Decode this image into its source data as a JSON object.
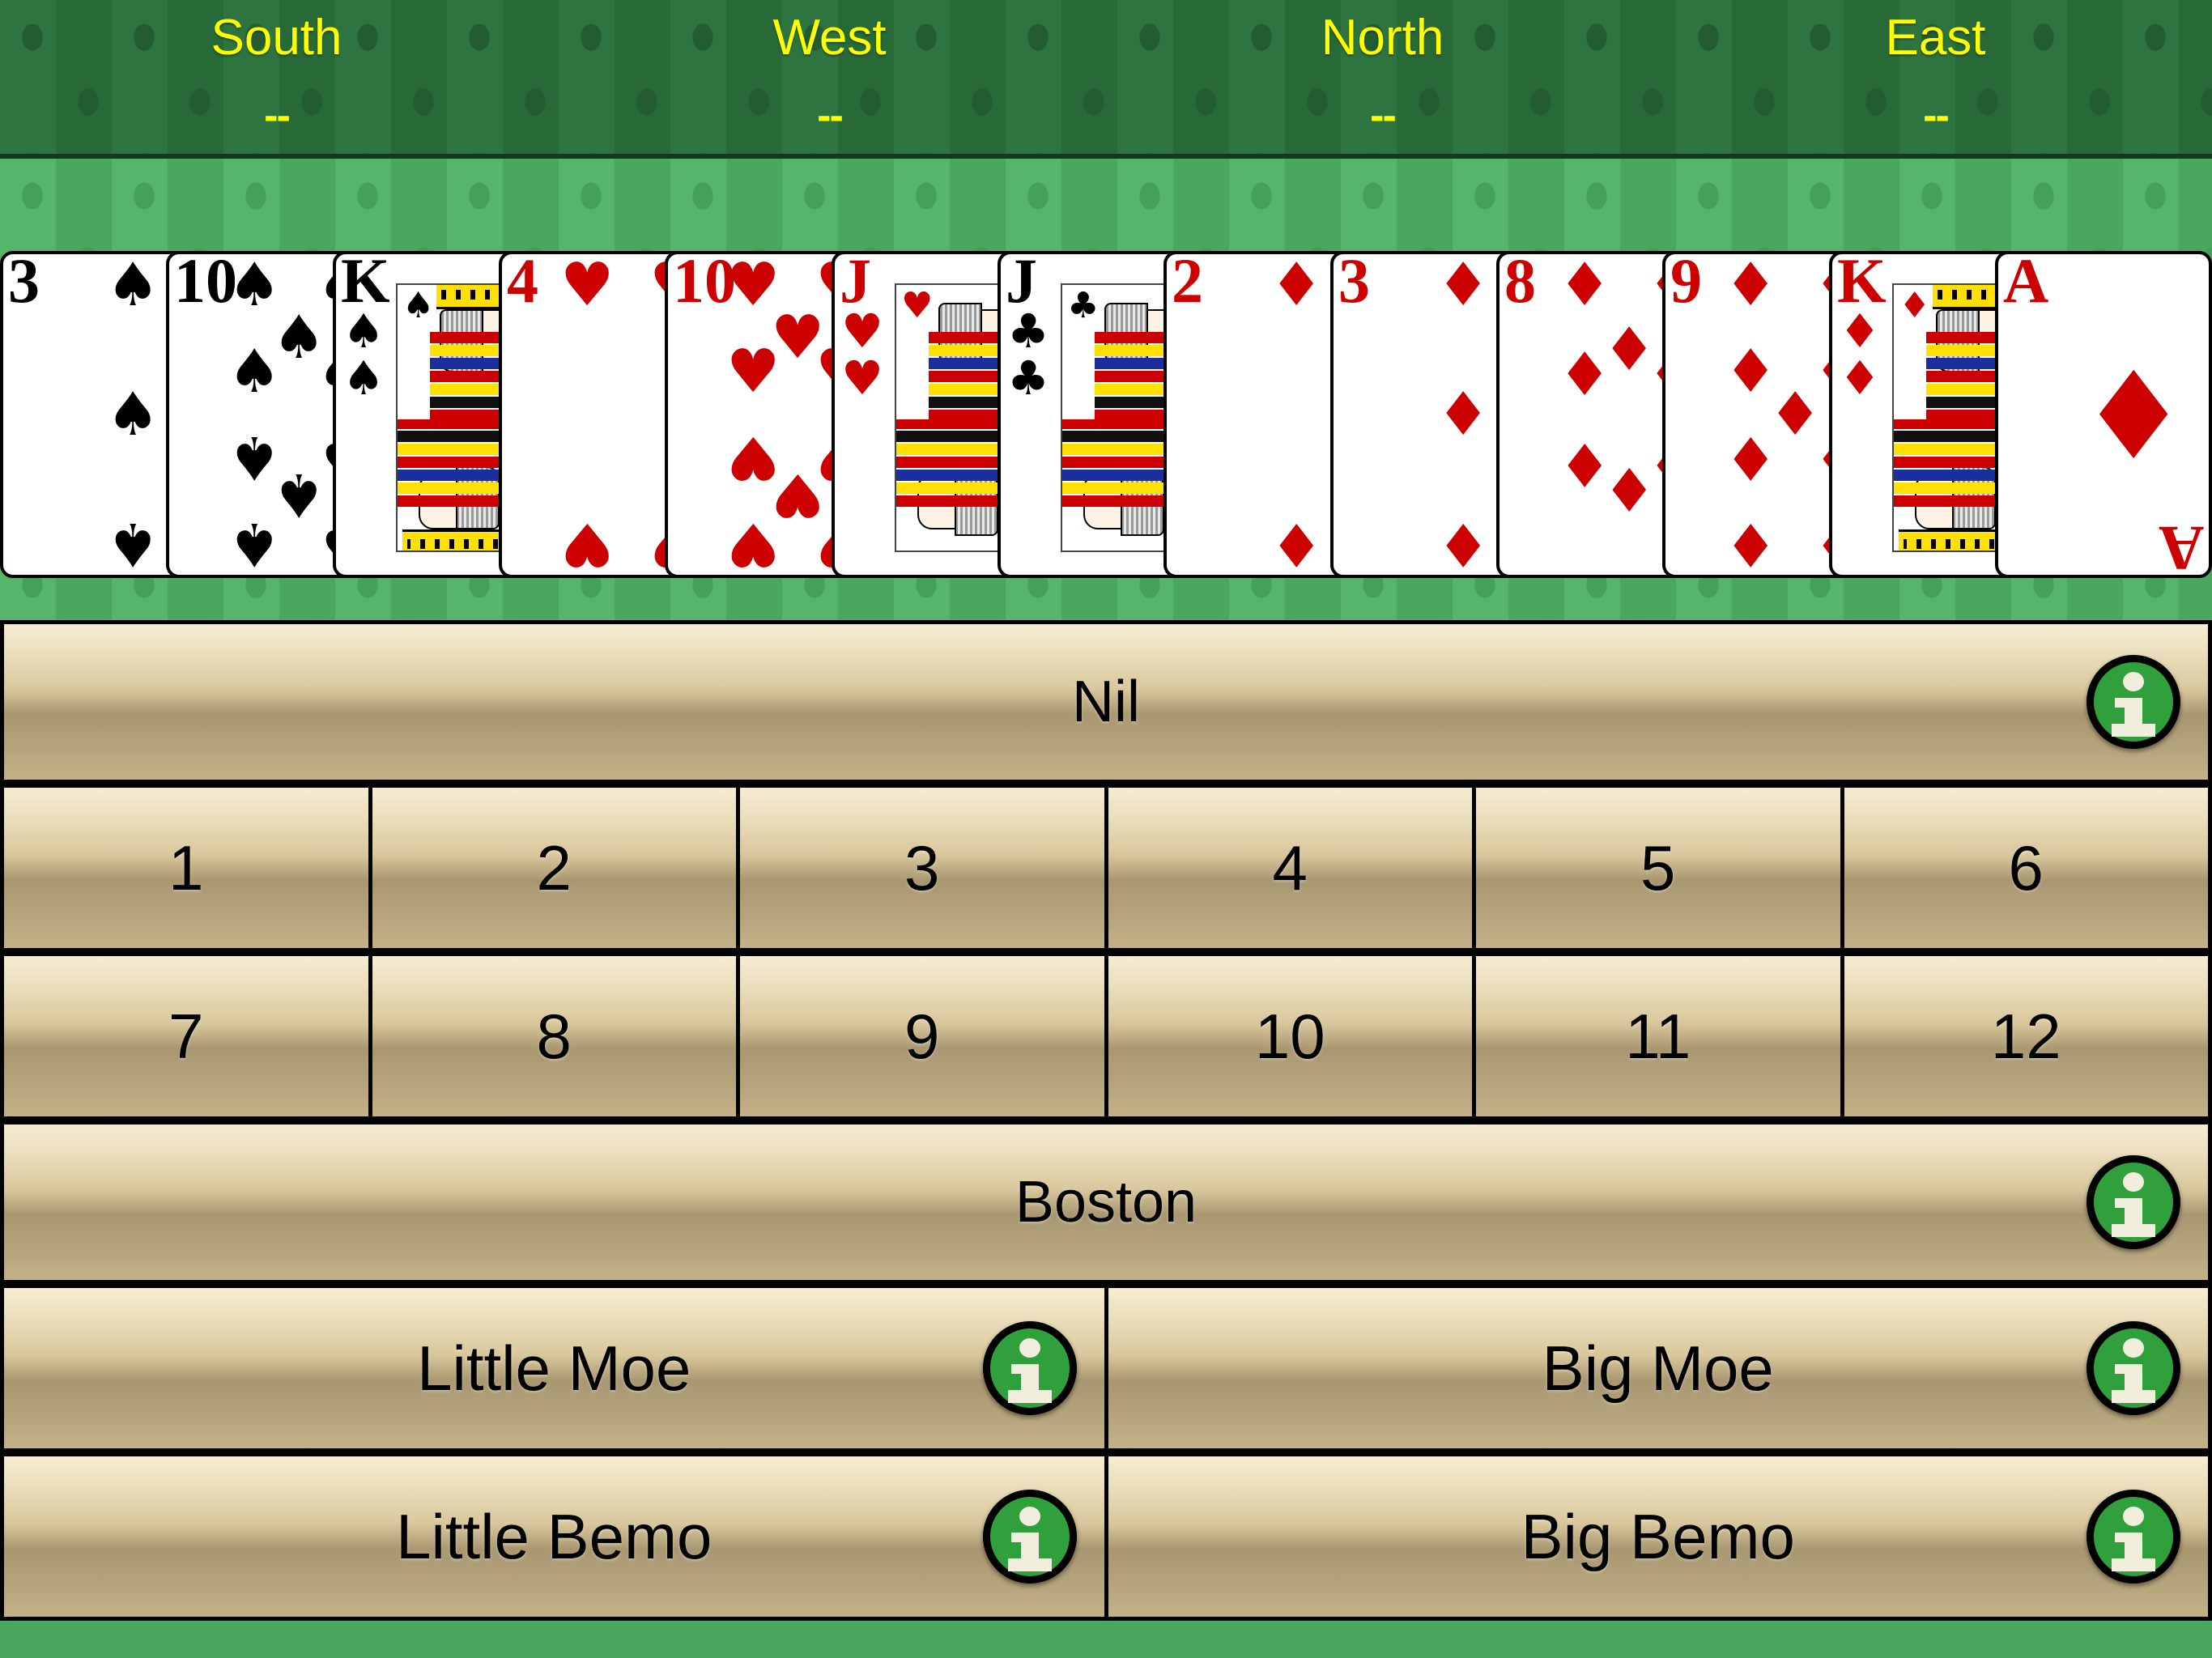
{
  "scoreboard": {
    "seats": [
      {
        "name": "South",
        "score": "--"
      },
      {
        "name": "West",
        "score": "--"
      },
      {
        "name": "North",
        "score": "--"
      },
      {
        "name": "East",
        "score": "--"
      }
    ],
    "name_color": "#ffff00",
    "background_color": "#2a6b38"
  },
  "table": {
    "felt_color": "#4eae63"
  },
  "hand": {
    "cards": [
      {
        "rank": "3",
        "suit": "spades",
        "symbol": "♠",
        "color": "black",
        "type": "number",
        "count": 3
      },
      {
        "rank": "10",
        "suit": "spades",
        "symbol": "♠",
        "color": "black",
        "type": "number",
        "count": 10
      },
      {
        "rank": "K",
        "suit": "spades",
        "symbol": "♠",
        "color": "black",
        "type": "face"
      },
      {
        "rank": "4",
        "suit": "hearts",
        "symbol": "♥",
        "color": "red",
        "type": "number",
        "count": 4
      },
      {
        "rank": "10",
        "suit": "hearts",
        "symbol": "♥",
        "color": "red",
        "type": "number",
        "count": 10
      },
      {
        "rank": "J",
        "suit": "hearts",
        "symbol": "♥",
        "color": "red",
        "type": "face"
      },
      {
        "rank": "J",
        "suit": "clubs",
        "symbol": "♣",
        "color": "black",
        "type": "face"
      },
      {
        "rank": "2",
        "suit": "diamonds",
        "symbol": "♦",
        "color": "red",
        "type": "number",
        "count": 2
      },
      {
        "rank": "3",
        "suit": "diamonds",
        "symbol": "♦",
        "color": "red",
        "type": "number",
        "count": 3
      },
      {
        "rank": "8",
        "suit": "diamonds",
        "symbol": "♦",
        "color": "red",
        "type": "number",
        "count": 8
      },
      {
        "rank": "9",
        "suit": "diamonds",
        "symbol": "♦",
        "color": "red",
        "type": "number",
        "count": 9
      },
      {
        "rank": "K",
        "suit": "diamonds",
        "symbol": "♦",
        "color": "red",
        "type": "face"
      },
      {
        "rank": "A",
        "suit": "diamonds",
        "symbol": "♦",
        "color": "red",
        "type": "ace"
      }
    ]
  },
  "bidding": {
    "nil": {
      "label": "Nil",
      "has_info": true
    },
    "numbers_row1": [
      {
        "label": "1"
      },
      {
        "label": "2"
      },
      {
        "label": "3"
      },
      {
        "label": "4"
      },
      {
        "label": "5"
      },
      {
        "label": "6"
      }
    ],
    "numbers_row2": [
      {
        "label": "7"
      },
      {
        "label": "8"
      },
      {
        "label": "9"
      },
      {
        "label": "10"
      },
      {
        "label": "11"
      },
      {
        "label": "12"
      }
    ],
    "boston": {
      "label": "Boston",
      "has_info": true
    },
    "specials": [
      {
        "label": "Little Moe",
        "has_info": true
      },
      {
        "label": "Big Moe",
        "has_info": true
      },
      {
        "label": "Little Bemo",
        "has_info": true
      },
      {
        "label": "Big Bemo",
        "has_info": true
      }
    ],
    "info_icon_name": "info-icon",
    "info_icon_color": "#2fa03c",
    "button_face_color": "#d9c79c"
  }
}
